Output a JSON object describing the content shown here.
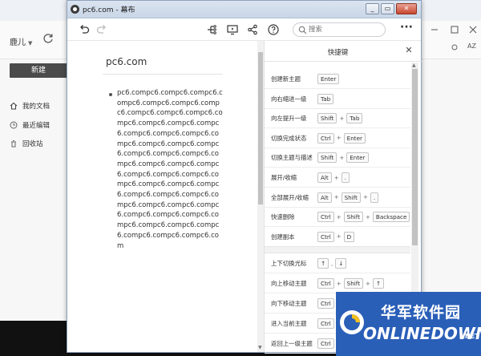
{
  "background_app": {
    "user_label": "鹿儿",
    "new_button": "新建",
    "nav": [
      {
        "label": "我的文档",
        "icon": "home-icon"
      },
      {
        "label": "最近编辑",
        "icon": "clock-icon"
      },
      {
        "label": "回收站",
        "icon": "trash-icon"
      }
    ]
  },
  "window": {
    "title": "pc6.com - 幕布",
    "controls": {
      "minimize": "_",
      "restore": "▭",
      "close": "✕"
    }
  },
  "toolbar": {
    "undo_icon": "undo-icon",
    "redo_icon": "redo-icon",
    "mindmap_icon": "mindmap-icon",
    "present_icon": "presentation-icon",
    "share_icon": "share-icon",
    "help_icon": "help-icon",
    "search_placeholder": "搜索",
    "more_label": "···"
  },
  "document": {
    "title": "pc6.com",
    "bullet_text": "pc6.compc6.compc6.compc6.compc6.compc6.compc6.compc6.compc6.compc6.compc6.compc6.compc6.compc6.compc6.compc6.compc6.compc6.compc6.compc6.compc6.compc6.compc6.compc6.compc6.compc6.compc6.compc6.compc6.compc6.compc6.compc6.compc6.compc6.compc6.compc6.compc6.compc6.compc6.compc6.compc6.compc6.compc6.compc6.compc6.compc6.compc6.compc6.compc6.compc6.compc6.compc6.compc6.com"
  },
  "shortcut_panel": {
    "title": "快捷键",
    "close_label": "✕",
    "rows": [
      {
        "label": "创建新主题",
        "keys": [
          "Enter"
        ]
      },
      {
        "label": "向右缩进一级",
        "keys": [
          "Tab"
        ]
      },
      {
        "label": "向左提升一级",
        "keys": [
          "Shift",
          "Tab"
        ]
      },
      {
        "label": "切换完成状态",
        "keys": [
          "Ctrl",
          "Enter"
        ]
      },
      {
        "label": "切换主题与描述",
        "keys": [
          "Shift",
          "Enter"
        ]
      },
      {
        "label": "展开/收缩",
        "keys": [
          "Alt",
          "."
        ]
      },
      {
        "label": "全部展开/收缩",
        "keys": [
          "Alt",
          "Shift",
          "."
        ]
      },
      {
        "label": "快速删除",
        "keys": [
          "Ctrl",
          "Shift",
          "Backspace"
        ]
      },
      {
        "label": "创建副本",
        "keys": [
          "Ctrl",
          "D"
        ]
      }
    ],
    "rows2": [
      {
        "label": "上下切换光标",
        "keys": [
          "↑",
          "↓"
        ],
        "sep": ","
      },
      {
        "label": "向上移动主题",
        "keys": [
          "Ctrl",
          "Shift",
          "↑"
        ]
      },
      {
        "label": "向下移动主题",
        "keys": [
          "Ctrl"
        ]
      },
      {
        "label": "进入当前主题",
        "keys": [
          "Ctrl"
        ]
      },
      {
        "label": "返回上一级主题",
        "keys": [
          "Ctrl"
        ]
      }
    ]
  },
  "watermark": {
    "cn_text": "华军软件园",
    "en_text": "ONLINEDOWN",
    "dotcom": ".NET"
  }
}
